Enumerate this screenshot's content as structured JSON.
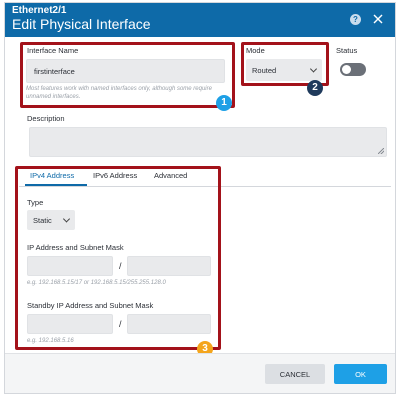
{
  "dialog": {
    "subtitle": "Ethernet2/1",
    "title": "Edit Physical Interface",
    "help_icon": "help-icon",
    "help_glyph": "?",
    "close_icon": "close-icon"
  },
  "form": {
    "interface_name": {
      "label": "Interface Name",
      "value": "firstinterface",
      "hint": "Most features work with named interfaces only, although some require unnamed interfaces."
    },
    "mode": {
      "label": "Mode",
      "value": "Routed"
    },
    "status": {
      "label": "Status",
      "enabled": false
    },
    "description": {
      "label": "Description",
      "value": ""
    }
  },
  "tabs": [
    {
      "label": "IPv4 Address",
      "active": true
    },
    {
      "label": "IPv6 Address",
      "active": false
    },
    {
      "label": "Advanced",
      "active": false
    }
  ],
  "ipv4": {
    "type_label": "Type",
    "type_value": "Static",
    "ip_label": "IP Address and Subnet Mask",
    "ip_value": "",
    "mask_value": "",
    "separator": "/",
    "ip_hint": "e.g. 192.168.5.15/17 or 192.168.5.15/255.255.128.0",
    "standby_label": "Standby IP Address and Subnet Mask",
    "standby_ip_value": "",
    "standby_mask_value": "",
    "standby_hint": "e.g. 192.168.5.16"
  },
  "callouts": {
    "one": {
      "number": "1",
      "color": "#1ea0e6"
    },
    "two": {
      "number": "2",
      "color": "#1f3a5c"
    },
    "three": {
      "number": "3",
      "color": "#f4a51c"
    },
    "highlight_color": "#a3121a"
  },
  "footer": {
    "cancel_label": "CANCEL",
    "ok_label": "OK"
  }
}
